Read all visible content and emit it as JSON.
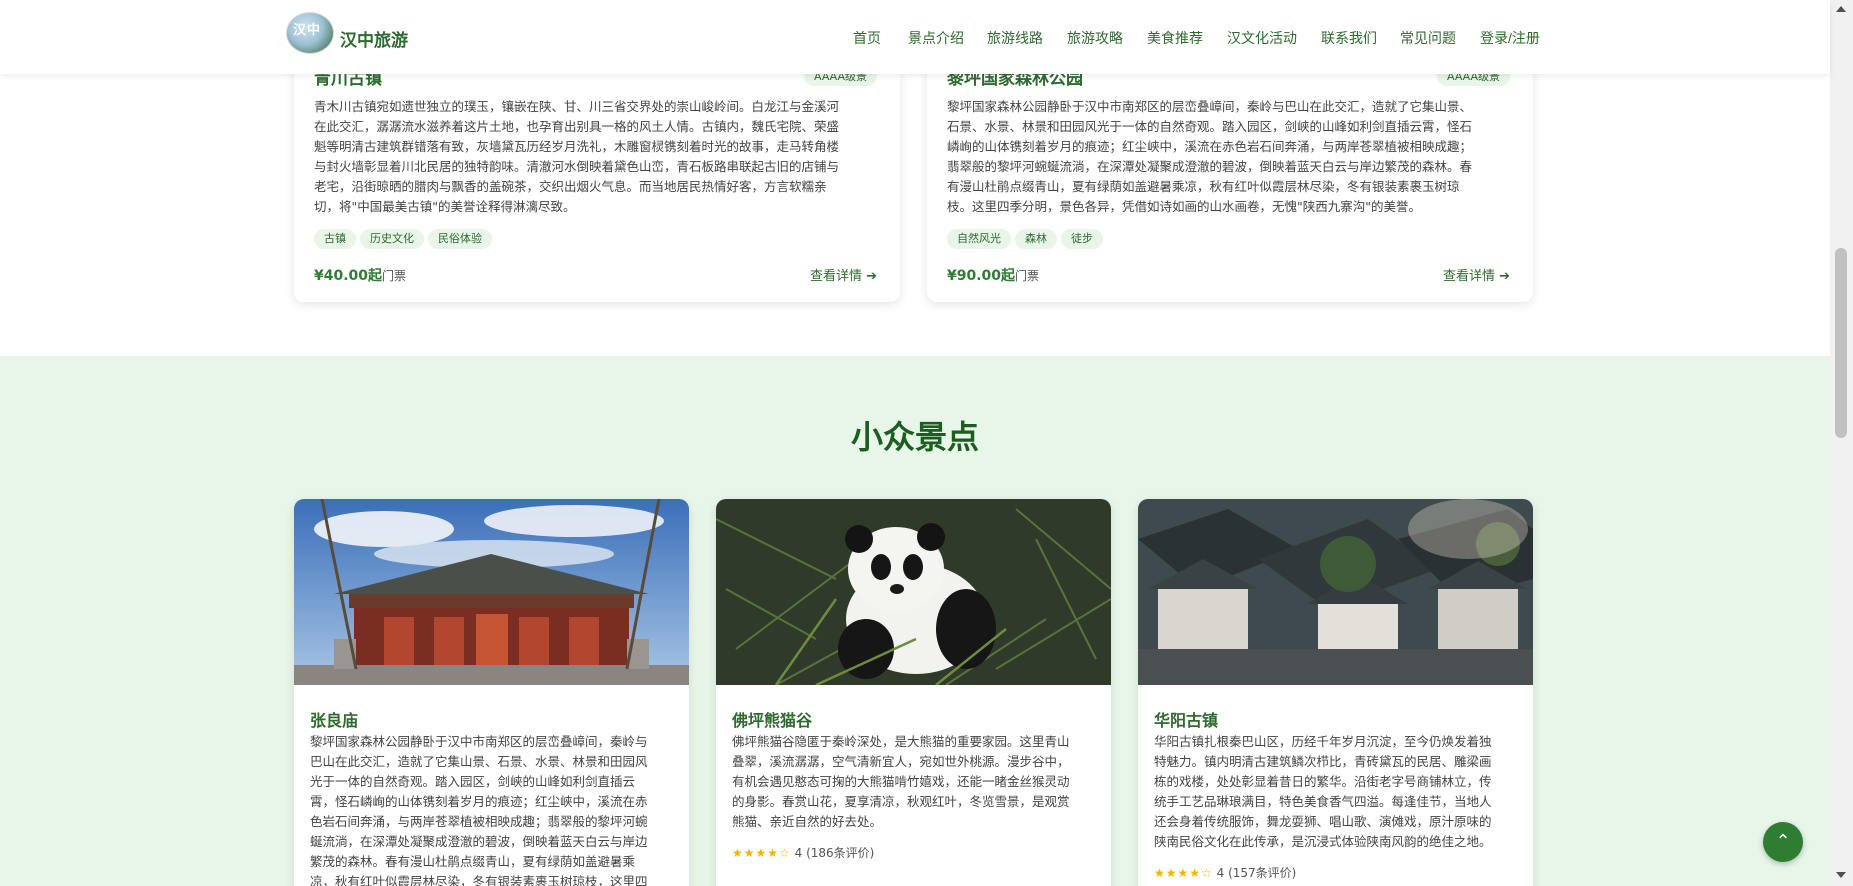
{
  "header": {
    "logo_text": "汉中",
    "brand": "汉中旅游",
    "nav": [
      "首页",
      "景点介绍",
      "旅游线路",
      "旅游攻略",
      "美食推荐",
      "汉文化活动",
      "联系我们",
      "常见问题",
      "登录/注册"
    ]
  },
  "top_cards": [
    {
      "title": "青川古镇",
      "rating_tag": "AAAA级景",
      "desc_lines": [
        "青木川古镇宛如遗世独立的璞玉，镶嵌在陕、甘、川三省交界处的崇山峻岭间。白龙江与金溪河",
        "在此交汇，潺潺流水滋养着这片土地，也孕育出别具一格的风土人情。古镇内，魏氏宅院、荣盛",
        "魁等明清古建筑群错落有致，灰墙黛瓦历经岁月洗礼，木雕窗棂镌刻着时光的故事，走马转角楼",
        "与封火墙彰显着川北民居的独特韵味。清澈河水倒映着黛色山峦，青石板路串联起古旧的店铺与",
        "老宅，沿街晾晒的腊肉与飘香的盖碗茶，交织出烟火气息。而当地居民热情好客，方言软糯亲",
        "切，将\"中国最美古镇\"的美誉诠释得淋漓尽致。"
      ],
      "tags": [
        "古镇",
        "历史文化",
        "民俗体验"
      ],
      "price": "¥40.00起",
      "price_unit": "门票",
      "detail": "查看详情 ➔"
    },
    {
      "title": "黎坪国家森林公园",
      "rating_tag": "AAAA级景",
      "desc_lines": [
        "黎坪国家森林公园静卧于汉中市南郑区的层峦叠嶂间，秦岭与巴山在此交汇，造就了它集山景、",
        "石景、水景、林景和田园风光于一体的自然奇观。踏入园区，剑峡的山峰如利剑直插云霄，怪石",
        "嶙峋的山体镌刻着岁月的痕迹；红尘峡中，溪流在赤色岩石间奔涌，与两岸苍翠植被相映成趣；",
        "翡翠般的黎坪河蜿蜒流淌，在深潭处凝聚成澄澈的碧波，倒映着蓝天白云与岸边繁茂的森林。春",
        "有漫山杜鹃点缀青山，夏有绿荫如盖避暑乘凉，秋有红叶似霞层林尽染，冬有银装素裹玉树琼",
        "枝。这里四季分明，景色各异，凭借如诗如画的山水画卷，无愧\"陕西九寨沟\"的美誉。"
      ],
      "tags": [
        "自然风光",
        "森林",
        "徒步"
      ],
      "price": "¥90.00起",
      "price_unit": "门票",
      "detail": "查看详情 ➔"
    }
  ],
  "section": {
    "title": "小众景点",
    "spots": [
      {
        "name": "张良庙",
        "desc_lines": [
          "黎坪国家森林公园静卧于汉中市南郑区的层峦叠嶂间，秦岭与",
          "巴山在此交汇，造就了它集山景、石景、水景、林景和田园风",
          "光于一体的自然奇观。踏入园区，剑峡的山峰如利剑直插云",
          "霄，怪石嶙峋的山体镌刻着岁月的痕迹；红尘峡中，溪流在赤",
          "色岩石间奔涌，与两岸苍翠植被相映成趣；翡翠般的黎坪河蜿",
          "蜒流淌，在深潭处凝聚成澄澈的碧波，倒映着蓝天白云与岸边",
          "繁茂的森林。春有漫山杜鹃点缀青山，夏有绿荫如盖避暑乘",
          "凉，秋有红叶似霞层林尽染，冬有银装素裹玉树琼枝，这里四"
        ],
        "rating_text": ""
      },
      {
        "name": "佛坪熊猫谷",
        "desc_lines": [
          "佛坪熊猫谷隐匿于秦岭深处，是大熊猫的重要家园。这里青山",
          "叠翠，溪流潺潺，空气清新宜人，宛如世外桃源。漫步谷中，",
          "有机会遇见憨态可掬的大熊猫啃竹嬉戏，还能一睹金丝猴灵动",
          "的身影。春赏山花，夏享清凉，秋观红叶，冬览雪景，是观赏",
          "熊猫、亲近自然的好去处。"
        ],
        "stars": "★★★★☆",
        "rating_text": "4 (186条评价)"
      },
      {
        "name": "华阳古镇",
        "desc_lines": [
          "华阳古镇扎根秦巴山区，历经千年岁月沉淀，至今仍焕发着独",
          "特魅力。镇内明清古建筑鳞次栉比，青砖黛瓦的民居、雕梁画",
          "栋的戏楼，处处彰显着昔日的繁华。沿街老字号商铺林立，传",
          "统手工艺品琳琅满目，特色美食香气四溢。每逢佳节，当地人",
          "还会身着传统服饰，舞龙耍狮、唱山歌、演傩戏，原汁原味的",
          "陕南民俗文化在此传承，是沉浸式体验陕南风韵的绝佳之地。"
        ],
        "stars": "★★★★☆",
        "rating_text": "4 (157条评价)"
      }
    ]
  },
  "fab": "⌃",
  "colors": {
    "accent": "#2e7d32",
    "section_bg": "#e8f5e9",
    "title_dark": "#1b5e20"
  }
}
